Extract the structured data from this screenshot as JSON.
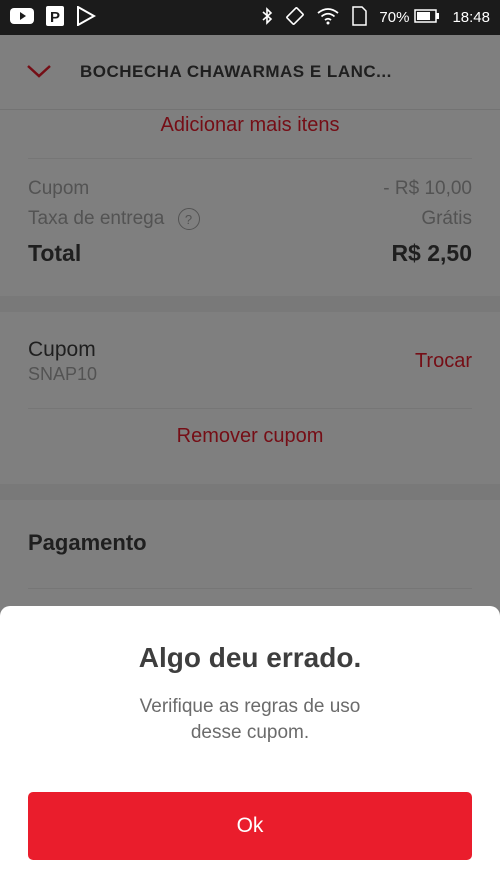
{
  "status_bar": {
    "battery": "70%",
    "time": "18:48",
    "icons": [
      "youtube-icon",
      "parking-app-icon",
      "play-store-icon",
      "bluetooth-icon",
      "rotate-icon",
      "wifi-icon",
      "sim-icon",
      "battery-icon"
    ]
  },
  "header": {
    "title": "BOCHECHA CHAWARMAS E LANC...",
    "collapse_icon": "chevron-down-icon"
  },
  "cart": {
    "add_more_label": "Adicionar mais itens"
  },
  "summary": {
    "coupon_label": "Cupom",
    "coupon_value": "- R$ 10,00",
    "delivery_label": "Taxa de entrega",
    "help_symbol": "?",
    "delivery_value": "Grátis",
    "total_label": "Total",
    "total_value": "R$ 2,50"
  },
  "coupon": {
    "label": "Cupom",
    "code": "SNAP10",
    "swap_label": "Trocar",
    "remove_label": "Remover cupom"
  },
  "payment": {
    "title": "Pagamento"
  },
  "dialog": {
    "title": "Algo deu errado.",
    "message_line1": "Verifique as regras de uso",
    "message_line2": "desse cupom.",
    "ok_label": "Ok"
  },
  "colors": {
    "brand_red": "#ea1d2c",
    "text_dark": "#3e3e3e",
    "text_muted": "#a6a6a6"
  }
}
